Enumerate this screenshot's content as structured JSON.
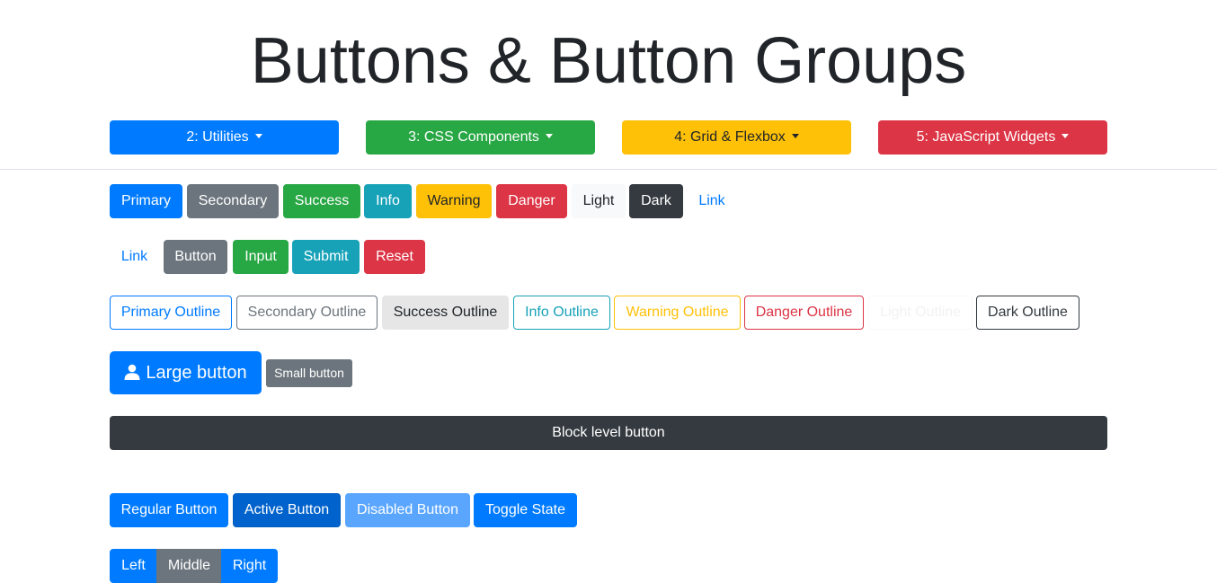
{
  "page": {
    "title": "Buttons & Button Groups"
  },
  "nav": [
    {
      "label": "2: Utilities"
    },
    {
      "label": "3: CSS Components"
    },
    {
      "label": "4: Grid & Flexbox"
    },
    {
      "label": "5: JavaScript Widgets"
    }
  ],
  "solid": {
    "primary": "Primary",
    "secondary": "Secondary",
    "success": "Success",
    "info": "Info",
    "warning": "Warning",
    "danger": "Danger",
    "light": "Light",
    "dark": "Dark",
    "link": "Link"
  },
  "types": {
    "link": "Link",
    "button": "Button",
    "input": "Input",
    "submit": "Submit",
    "reset": "Reset"
  },
  "outline": {
    "primary": "Primary Outline",
    "secondary": "Secondary Outline",
    "success": "Success Outline",
    "info": "Info Outline",
    "warning": "Warning Outline",
    "danger": "Danger Outline",
    "light": "Light Outline",
    "dark": "Dark Outline"
  },
  "sizes": {
    "large": "Large button",
    "small": "Small button"
  },
  "block": {
    "label": "Block level button"
  },
  "states": {
    "regular": "Regular Button",
    "active": "Active Button",
    "disabled": "Disabled Button",
    "toggle": "Toggle State"
  },
  "group": {
    "left": "Left",
    "middle": "Middle",
    "right": "Right"
  },
  "colors": {
    "primary": "#007bff",
    "secondary": "#6c757d",
    "success": "#28a745",
    "info": "#17a2b8",
    "warning": "#ffc107",
    "danger": "#dc3545",
    "light": "#f8f9fa",
    "dark": "#343a40"
  },
  "icons": {
    "large_button": "user-icon",
    "dropdown": "caret-down-icon"
  }
}
